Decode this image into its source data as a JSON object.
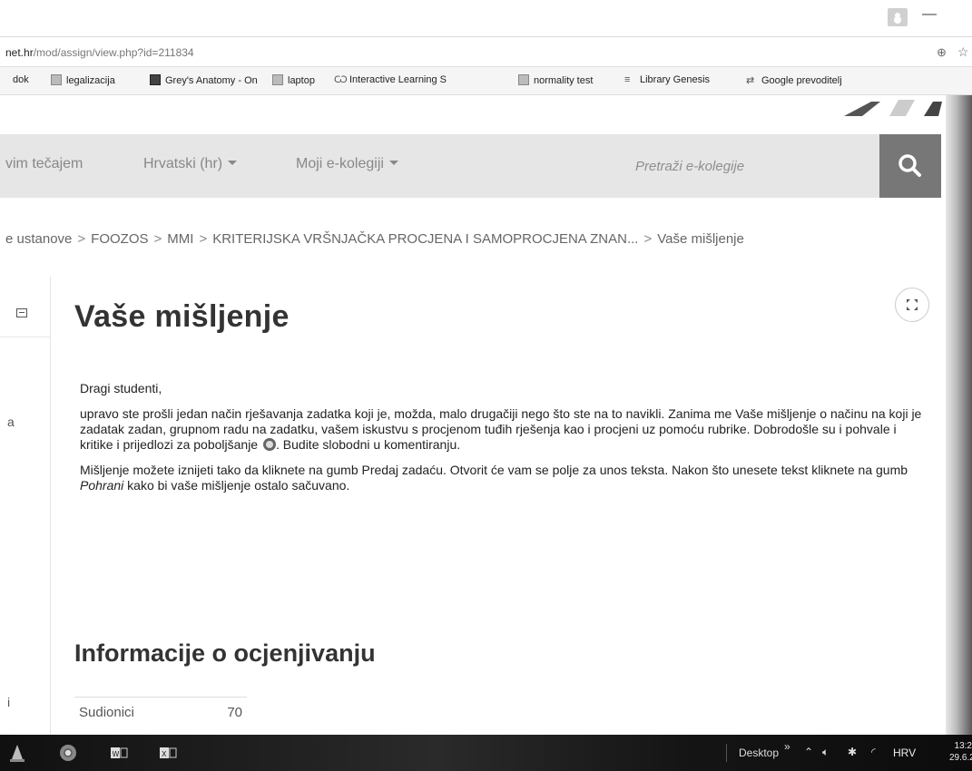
{
  "browser": {
    "url_host": "net.hr",
    "url_path": "/mod/assign/view.php?id=211834",
    "bookmarks": [
      {
        "label": "dok",
        "icon": "none"
      },
      {
        "label": "legalizacija",
        "icon": "page-icon"
      },
      {
        "label": "Grey's Anatomy - On",
        "icon": "film-icon"
      },
      {
        "label": "laptop",
        "icon": "page-icon"
      },
      {
        "label": "Interactive Learning S",
        "icon": "w-logo-icon"
      },
      {
        "label": "normality test",
        "icon": "page-icon"
      },
      {
        "label": "Library Genesis",
        "icon": "book-icon"
      },
      {
        "label": "Google prevoditelj",
        "icon": "translate-icon"
      }
    ]
  },
  "nav": {
    "items": [
      {
        "label": "vim tečajem"
      },
      {
        "label": "Hrvatski (hr)"
      },
      {
        "label": "Moji e-kolegiji"
      }
    ],
    "search_placeholder": "Pretraži e-kolegije"
  },
  "breadcrumb": [
    "e ustanove",
    "FOOZOS",
    "MMI",
    "KRITERIJSKA VRŠNJAČKA PROCJENA I SAMOPROCJENA ZNAN...",
    "Vaše mišljenje"
  ],
  "sidebar": {
    "letter_a": "a",
    "letter_i": "i"
  },
  "page": {
    "title": "Vaše mišljenje",
    "greeting": "Dragi studenti,",
    "para1": "upravo ste prošli jedan način rješavanja zadatka koji je, možda, malo drugačiji nego što ste na to navikli. Zanima me Vaše mišljenje o načinu na koji je zadatak zadan, grupnom radu na zadatku, vašem iskustvu s procjenom tuđih rješenja kao i procjeni uz pomoću rubrike. Dobrodošle su i pohvale i kritike i prijedlozi za poboljšanje",
    "para1_end": ". Budite slobodni u komentiranju.",
    "para2_a": "Mišljenje možete iznijeti tako da kliknete na gumb Predaj zadaću. Otvorit će vam se polje za unos teksta. Nakon što unesete tekst kliknete na gumb ",
    "para2_em": "Pohrani",
    "para2_b": " kako bi vaše mišljenje ostalo sačuvano.",
    "section_title": "Informacije o ocjenjivanju",
    "grading": [
      {
        "label": "Sudionici",
        "value": "70"
      }
    ]
  },
  "taskbar": {
    "desktop_label": "Desktop",
    "language": "HRV",
    "time": "13:2",
    "date": "29.6.2"
  }
}
